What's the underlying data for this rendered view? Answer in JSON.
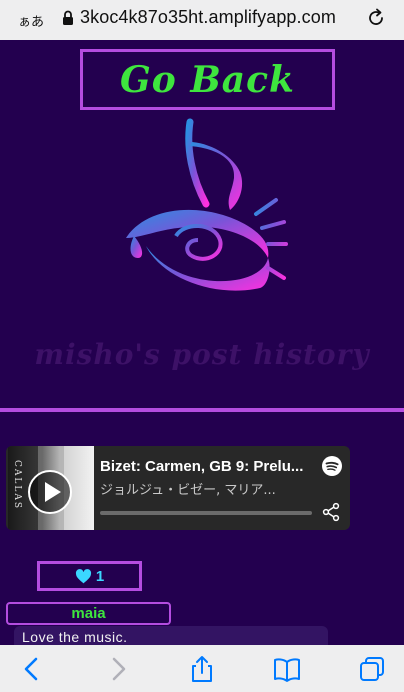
{
  "browser": {
    "text_size_label": "ぁあ",
    "url": "3koc4k87o35ht.amplifyapp.com",
    "accent": "#007aff"
  },
  "page": {
    "go_back_label": "Go Back",
    "history_title": "misho's post history",
    "accent_color": "#b44de0",
    "background_color": "#23004f"
  },
  "embed": {
    "cover_text": "CALLAS",
    "track_title": "Bizet: Carmen, GB 9: Prelu...",
    "artist": "ジョルジュ・ビゼー, マリア...",
    "progress": 0
  },
  "post": {
    "like_count": "1",
    "comment_author": "maia",
    "comment_text": "Love the music."
  },
  "icons": {
    "lock": "lock-icon",
    "reload": "reload-icon",
    "heart": "heart-icon",
    "spotify": "spotify-icon",
    "share": "share-icon",
    "play": "play-icon"
  }
}
